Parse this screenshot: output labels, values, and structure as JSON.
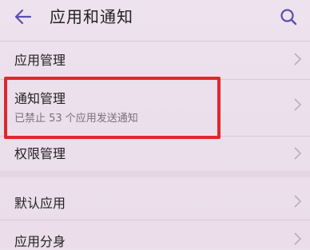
{
  "header": {
    "back_icon": "arrow-left-icon",
    "title": "应用和通知",
    "search_icon": "search-icon"
  },
  "items": [
    {
      "label": "应用管理",
      "sublabel": ""
    },
    {
      "label": "通知管理",
      "sublabel": "已禁止 53 个应用发送通知"
    },
    {
      "label": "权限管理",
      "sublabel": ""
    },
    {
      "label": "默认应用",
      "sublabel": ""
    },
    {
      "label": "应用分身",
      "sublabel": ""
    }
  ],
  "colors": {
    "background": "#ece0ec",
    "highlight_border": "#e3262b",
    "icon_accent": "#5a4fb0"
  }
}
